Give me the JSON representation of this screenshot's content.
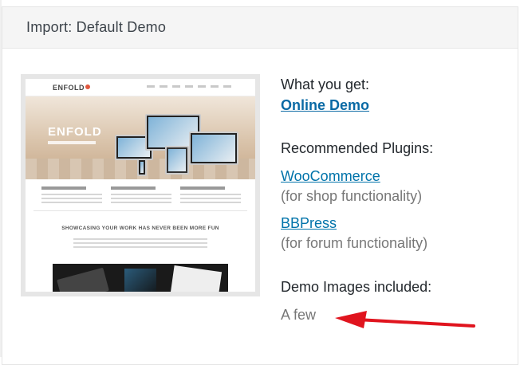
{
  "panel": {
    "title": "Import: Default Demo"
  },
  "preview": {
    "logo": "ENFOLD",
    "hero_title": "ENFOLD",
    "tagline": "SHOWCASING YOUR WORK HAS NEVER BEEN MORE FUN"
  },
  "info": {
    "what_you_get_heading": "What you get:",
    "online_demo_link": "Online Demo",
    "plugins_heading": "Recommended Plugins:",
    "plugins": [
      {
        "name": "WooCommerce",
        "note": "(for shop functionality)"
      },
      {
        "name": "BBPress",
        "note": "(for forum functionality)"
      }
    ],
    "images_heading": "Demo Images included:",
    "images_value": "A few"
  },
  "annotation": {
    "arrow_color": "#e0141e",
    "arrow_icon": "red-arrow-icon"
  }
}
